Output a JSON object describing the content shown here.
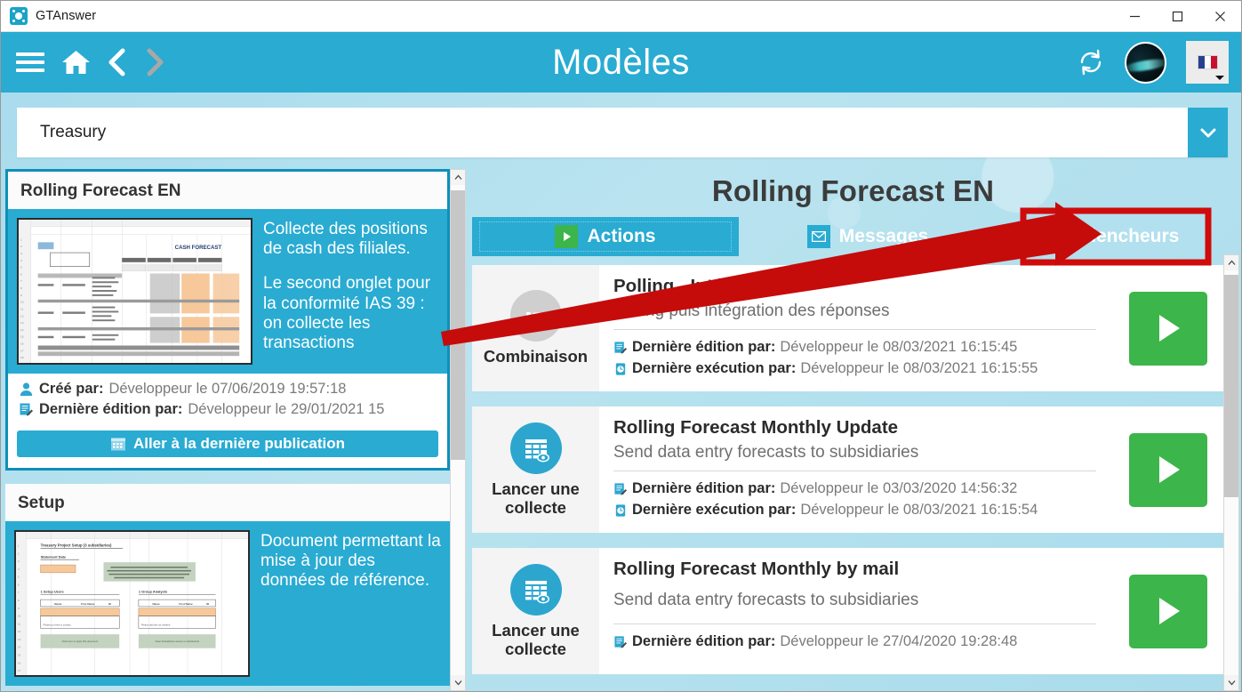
{
  "window": {
    "title": "GTAnswer",
    "app_icon": "gtanswer-logo-icon",
    "minimize": "–",
    "maximize": "□",
    "close": "✕"
  },
  "header": {
    "title": "Modèles",
    "menu_icon": "hamburger-menu-icon",
    "home_icon": "home-icon",
    "back_icon": "chevron-left-icon",
    "forward_icon": "chevron-right-icon",
    "refresh_icon": "refresh-icon",
    "avatar_icon": "user-avatar",
    "language": "fr",
    "language_icon": "french-flag-icon"
  },
  "selector": {
    "value": "Treasury",
    "caret_icon": "chevron-down-icon"
  },
  "left_panel": {
    "scrollbar": {
      "up_icon": "chevron-up-icon",
      "down_icon": "chevron-down-icon",
      "thumb_top_pct": 3,
      "thumb_height_pct": 55
    },
    "cards": [
      {
        "title": "Rolling Forecast EN",
        "selected": true,
        "thumbnail_title": "CASH FORECAST",
        "description": [
          "Collecte des positions de cash des filiales.",
          "Le second onglet pour la conformité IAS 39 : on collecte les transactions"
        ],
        "meta": [
          {
            "icon": "user-icon",
            "label": "Créé par:",
            "value": "Développeur le 07/06/2019 19:57:18"
          },
          {
            "icon": "edit-document-icon",
            "label": "Dernière édition par:",
            "value": "Développeur le 29/01/2021 15"
          }
        ],
        "button": {
          "label": "Aller à la dernière publication",
          "icon": "calendar-icon"
        }
      },
      {
        "title": "Setup",
        "selected": false,
        "thumbnail_title": "Treasury Project Setup (3 subsidiaries)",
        "description": [
          "Document permettant la mise à jour des données de référence."
        ],
        "meta": [],
        "button": null
      }
    ]
  },
  "right_panel": {
    "title": "Rolling Forecast EN",
    "scrollbar": {
      "up_icon": "chevron-up-icon",
      "down_icon": "chevron-down-icon",
      "thumb_top_pct": 1,
      "thumb_height_pct": 55
    },
    "tabs": [
      {
        "label": "Actions",
        "icon": "play-icon",
        "active": true,
        "highlighted": false
      },
      {
        "label": "Messages",
        "icon": "mail-icon",
        "active": false,
        "highlighted": false
      },
      {
        "label": "Déclencheurs",
        "icon": "trigger-search-icon",
        "active": false,
        "highlighted": true
      }
    ],
    "actions": [
      {
        "type_label": "Combinaison",
        "type_icon": "combination-icon",
        "title": "Polling - Intégration",
        "subtitle": "Polling puis intégration des réponses",
        "meta": [
          {
            "icon": "edit-document-icon",
            "label": "Dernière édition par:",
            "value": "Développeur le 08/03/2021 16:15:45"
          },
          {
            "icon": "clock-run-icon",
            "label": "Dernière exécution par:",
            "value": "Développeur le 08/03/2021 16:15:55"
          }
        ],
        "run_button": {
          "icon": "play-icon"
        }
      },
      {
        "type_label": "Lancer une collecte",
        "type_icon": "collect-table-icon",
        "title": "Rolling Forecast Monthly Update",
        "subtitle": "Send data entry forecasts to subsidiaries",
        "meta": [
          {
            "icon": "edit-document-icon",
            "label": "Dernière édition par:",
            "value": "Développeur le 03/03/2020 14:56:32"
          },
          {
            "icon": "clock-run-icon",
            "label": "Dernière exécution par:",
            "value": "Développeur le 08/03/2021 16:15:54"
          }
        ],
        "run_button": {
          "icon": "play-icon"
        }
      },
      {
        "type_label": "Lancer une collecte",
        "type_icon": "collect-table-icon",
        "title": "Rolling Forecast Monthly by mail",
        "subtitle": "Send data entry forecasts to subsidiaries",
        "meta": [
          {
            "icon": "edit-document-icon",
            "label": "Dernière édition par:",
            "value": "Développeur le 27/04/2020 19:28:48"
          }
        ],
        "run_button": {
          "icon": "play-icon"
        }
      }
    ]
  },
  "annotation": {
    "arrow_color": "#c60b0b",
    "highlight_box_color": "#d10a0a",
    "points_to": "Déclencheurs"
  },
  "colors": {
    "brand_cyan": "#29abd2",
    "body_blue": "#aadcec",
    "green": "#3cb54a",
    "annotation_red": "#c60b0b"
  }
}
